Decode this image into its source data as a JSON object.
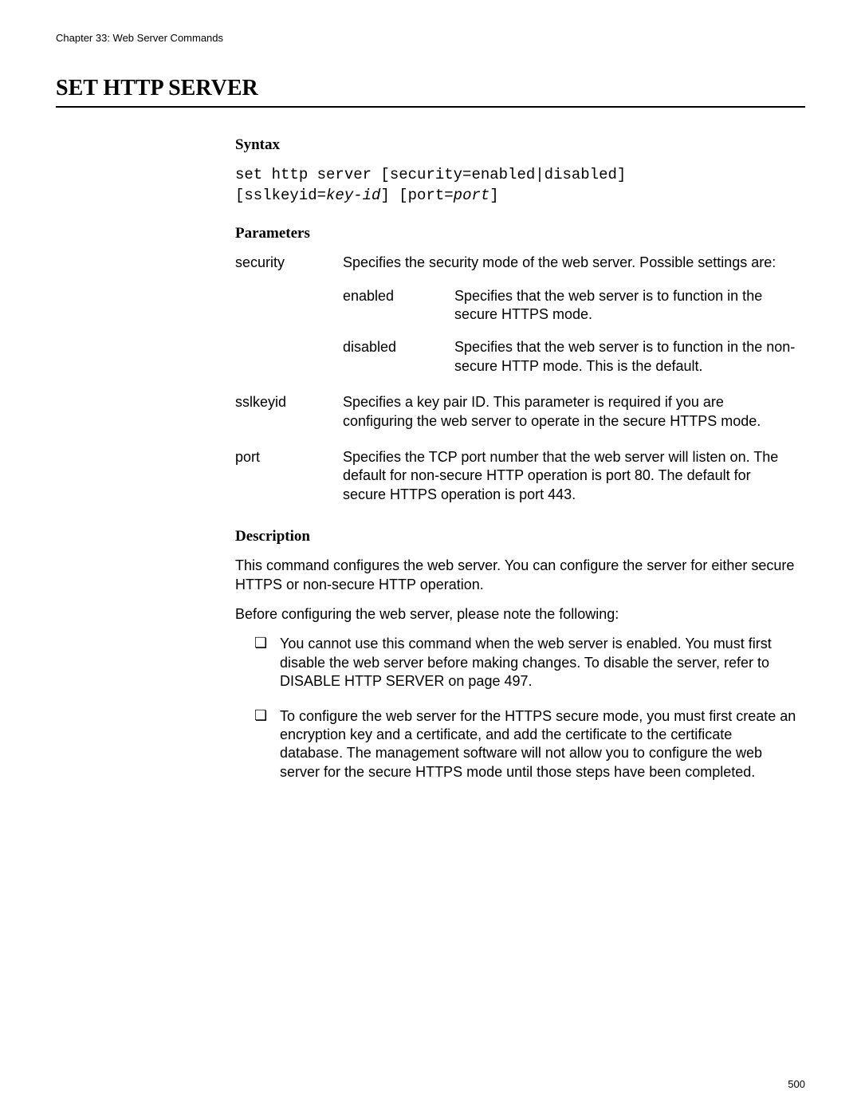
{
  "chapter_header": "Chapter 33: Web Server Commands",
  "command_title": "SET HTTP SERVER",
  "syntax": {
    "heading": "Syntax",
    "line1_a": "set http server [security=enabled|disabled]",
    "line2_a": "[sslkeyid=",
    "line2_b": "key-id",
    "line2_c": "] [port=",
    "line2_d": "port",
    "line2_e": "]"
  },
  "parameters": {
    "heading": "Parameters",
    "rows": [
      {
        "name": "security",
        "desc": "Specifies the security mode of the web server. Possible settings are:",
        "sub": [
          {
            "name": "enabled",
            "desc": "Specifies that the web server is to function in the secure HTTPS mode."
          },
          {
            "name": "disabled",
            "desc": "Specifies that the web server is to function in the non-secure HTTP mode. This is the default."
          }
        ]
      },
      {
        "name": "sslkeyid",
        "desc": "Specifies a key pair ID. This parameter is required if you are configuring the web server to operate in the secure HTTPS mode."
      },
      {
        "name": "port",
        "desc": "Specifies the TCP port number that the web server will listen on. The default for non-secure HTTP operation is port 80. The default for secure HTTPS operation is port 443."
      }
    ]
  },
  "description": {
    "heading": "Description",
    "p1": "This command configures the web server. You can configure the server for either secure HTTPS or non-secure HTTP operation.",
    "p2": "Before configuring the web server, please note the following:",
    "bullets": [
      "You cannot use this command when the web server is enabled. You must first disable the web server before making changes. To disable the server, refer to DISABLE HTTP SERVER on page 497.",
      "To configure the web server for the HTTPS secure mode, you must first create an encryption key and a certificate, and add the certificate to the certificate database. The management software will not allow you to configure the web server for the secure HTTPS mode until those steps have been completed."
    ]
  },
  "page_number": "500"
}
